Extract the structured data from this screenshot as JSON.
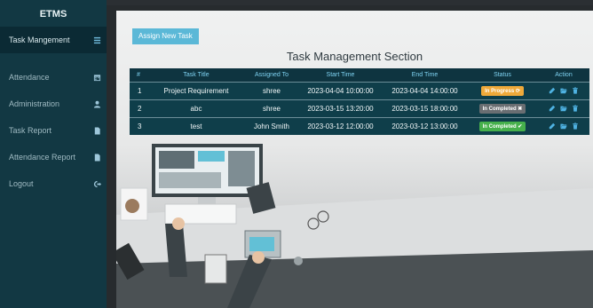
{
  "sidebar": {
    "brand": "ETMS",
    "items": [
      {
        "label": "Task Mangement",
        "icon": "list-icon",
        "active": true
      },
      {
        "label": "Attendance",
        "icon": "calendar-icon",
        "active": false
      },
      {
        "label": "Administration",
        "icon": "user-icon",
        "active": false
      },
      {
        "label": "Task Report",
        "icon": "file-icon",
        "active": false
      },
      {
        "label": "Attendance Report",
        "icon": "file-icon",
        "active": false
      },
      {
        "label": "Logout",
        "icon": "logout-icon",
        "active": false
      }
    ]
  },
  "main": {
    "assign_button": "Assign New Task",
    "section_title": "Task Management Section",
    "columns": [
      "#",
      "Task Title",
      "Assigned To",
      "Start Time",
      "End Time",
      "Status",
      "Action"
    ],
    "rows": [
      {
        "num": "1",
        "title": "Project Requirement",
        "assigned": "shree",
        "start": "2023-04-04 10:00:00",
        "end": "2023-04-04 14:00:00",
        "status": "In Progress ⟳",
        "status_color": "#f0a93a"
      },
      {
        "num": "2",
        "title": "abc",
        "assigned": "shree",
        "start": "2023-03-15 13:20:00",
        "end": "2023-03-15 18:00:00",
        "status": "In Completed ✖",
        "status_color": "#6a6e72"
      },
      {
        "num": "3",
        "title": "test",
        "assigned": "John Smith",
        "start": "2023-03-12 12:00:00",
        "end": "2023-03-12 13:00:00",
        "status": "In Completed ✔",
        "status_color": "#46b04c"
      }
    ]
  },
  "colors": {
    "sidebar": "#123843",
    "table_header": "#0e3440",
    "table_row": "#0f3e4a",
    "accent": "#5bb8d7",
    "action_icon": "#4fb2e2"
  }
}
